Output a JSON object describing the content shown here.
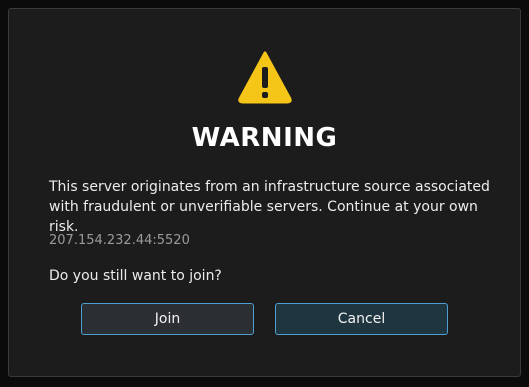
{
  "dialog": {
    "icon": "warning-icon",
    "title": "WARNING",
    "message_line1": "This server originates from an infrastructure source associated",
    "message_line2": "with fraudulent or unverifiable servers. Continue at your own risk.",
    "server_address": "207.154.232.44:5520",
    "question": "Do you still want to join?",
    "join_label": "Join",
    "cancel_label": "Cancel"
  },
  "colors": {
    "background": "#0b0b0b",
    "dialog": "#1c1c1c",
    "warning_yellow": "#f5c518",
    "button_border": "#4f9fd0"
  }
}
